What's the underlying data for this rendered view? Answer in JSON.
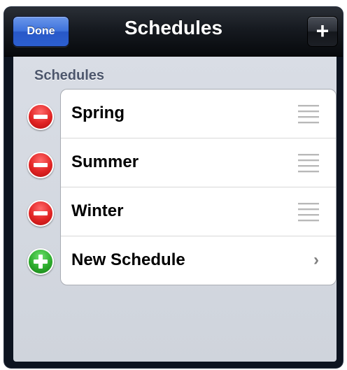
{
  "navbar": {
    "title": "Schedules",
    "done_label": "Done",
    "add_label": "+"
  },
  "section": {
    "header": "Schedules"
  },
  "rows": [
    {
      "label": "Spring",
      "control": "delete",
      "accessory": "reorder-grip-icon"
    },
    {
      "label": "Summer",
      "control": "delete",
      "accessory": "reorder-grip-icon"
    },
    {
      "label": "Winter",
      "control": "delete",
      "accessory": "reorder-grip-icon"
    },
    {
      "label": "New Schedule",
      "control": "insert",
      "accessory": "chevron-right-icon",
      "chevron": "›"
    }
  ],
  "colors": {
    "done_button": "#3e72dc",
    "delete_control": "#e12424",
    "insert_control": "#2cab2c",
    "section_header": "#4c566c"
  }
}
